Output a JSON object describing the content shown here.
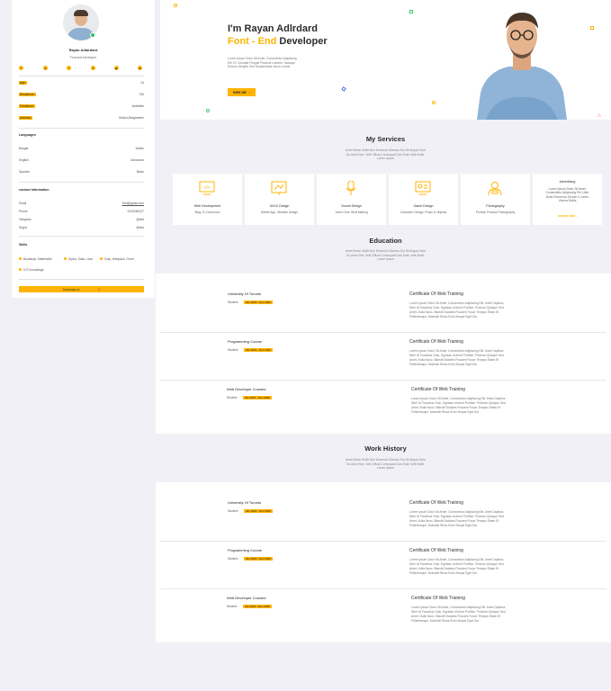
{
  "profile": {
    "name": "Rayan Adlardard",
    "role": "Font-end Developer",
    "social_icons": [
      "facebook-icon",
      "instagram-icon",
      "twitter-icon",
      "linkedin-icon",
      "youtube-icon",
      "dribbble-icon"
    ],
    "info": [
      {
        "label": "Age:",
        "value": "24"
      },
      {
        "label": "Residence:",
        "value": "BD"
      },
      {
        "label": "Freelance:",
        "value": "Available"
      },
      {
        "label": "Address:",
        "value": "Dhaka,Bangladesh"
      }
    ],
    "languages_title": "Languages",
    "languages": [
      {
        "name": "Bangla",
        "level": "Native"
      },
      {
        "name": "English",
        "level": "Advanced"
      },
      {
        "name": "Spanish",
        "level": "Basic"
      }
    ],
    "contact_title": "contact Information",
    "contact": [
      {
        "label": "Email",
        "value": "Test@gmail.com"
      },
      {
        "label": "Phone",
        "value": "0913283127"
      },
      {
        "label": "Telegram",
        "value": "@test"
      },
      {
        "label": "Skype",
        "value": "@test"
      }
    ],
    "skills_title": "Skills",
    "skills": [
      "Bootstrap, Materialize",
      "Stylus, Sass, Less",
      "Gulp, Webpack, Grunt",
      "GIT Knowledge"
    ],
    "download_label": "Download cv"
  },
  "hero": {
    "greeting": "I'm Rayan Adlrdard",
    "accent": "Font - End",
    "title_rest": " Developer",
    "lorem_lines": [
      "Lorem Ipsum Dolor Sit Amet, Consectetur Adipiscing",
      "Elit. Et, Volutpat Feugiat Placerat Lobortis. Natoque",
      "Rutrum Semper Sed Suspendisse Nunc Lectus."
    ],
    "button": "HIRE ME"
  },
  "services": {
    "title": "My Services",
    "subtitle": [
      "Amet Minim Mollit Non Deserunt Ullamco Est Sit Aliqua Dolor",
      "Do Amet Sint. Velit Officia Consequat Duis Enim Velit Mollit.",
      "Lorem Ipsum"
    ],
    "items": [
      {
        "name": "Web Development",
        "desc": "Blog, E-Commerce",
        "icon": "code-monitor-icon"
      },
      {
        "name": "UI/UX Design",
        "desc": "Mobile App, Website Design",
        "icon": "design-board-icon"
      },
      {
        "name": "Sound Design",
        "desc": "Voice Over, Beat Making",
        "icon": "microphone-icon"
      },
      {
        "name": "Game Design",
        "desc": "Character Design, Props & Objects",
        "icon": "game-screen-icon"
      },
      {
        "name": "Photography",
        "desc": "Portrait, Product Photography",
        "icon": "photographer-icon"
      },
      {
        "name": "Advertising",
        "desc_lines": [
          "Lorem Ipsum Dolor Sit Amet,",
          "Consectetur Adipiscing Elit, Ulter",
          "Nulla Dictum Ac Dictum Il Lorem",
          "Viverra Mollis"
        ],
        "link": "ORDER NOW"
      }
    ]
  },
  "education": {
    "title": "Education",
    "subtitle": [
      "Amet Minim Mollit Non Deserunt Ullamco Est Sit Aliqua Dolor",
      "Do Amet Sint. Velit Officia Consequat Duis Enim Velit Mollit.",
      "Lorem Ipsum"
    ],
    "entries": [
      {
        "name": "University Of Toronto",
        "label": "Student",
        "date": "Jan 2016 - Dec 2020",
        "cert": "Certificate Of Web Training",
        "desc": [
          "Lorem Ipsum Dolor Sit Amet, Consectetur Adipiscing Elit. Amet Dapibus",
          "Nibh Ut Faucibus Gutc, Egestas Id Amet Portitior. Pulvinar Quisque Sed",
          "Amet, Nulla Nunc. Blandit Sodales Posuere Fusce Tempus Etiam Et",
          "Pellentesque. Molestie Risus Enim Neque Eget Dui."
        ]
      },
      {
        "name": "Programming Course",
        "label": "Student",
        "date": "Jan 2016 - Dec 2020",
        "cert": "Certificate Of Web Training",
        "desc": [
          "Lorem Ipsum Dolor Sit Amet, Consectetur Adipiscing Elit. Amet Dapibus",
          "Nibh Ut Faucibus Gutc, Egestas Id Amet Portitior. Pulvinar Quisque Sed",
          "Amet, Nulla Nunc. Blandit Sodales Posuere Fusce Tempus Etiam Et",
          "Pellentesque. Molestie Risus Enim Neque Eget Dui."
        ]
      },
      {
        "name": "Web Developer Courses",
        "label": "Student",
        "date": "Jan 2016 - Dec 2020",
        "cert": "Certificate Of Web Training",
        "desc": [
          "Lorem Ipsum Dolor Sit Amet, Consectetur Adipiscing Elit. Amet Dapibus",
          "Nibh Ut Faucibus Gutc, Egestas Id Amet Portitior. Pulvinar Quisque Sed",
          "Amet, Nulla Nunc. Blandit Sodales Posuere Fusce Tempus Etiam Et",
          "Pellentesque. Molestie Risus Enim Neque Eget Dui."
        ]
      }
    ]
  },
  "work": {
    "title": "Work History",
    "subtitle": [
      "Amet Minim Mollit Non Deserunt Ullamco Est Sit Aliqua Dolor",
      "Do Amet Sint. Velit Officia Consequat Duis Enim Velit Mollit.",
      "Lorem Ipsum"
    ],
    "entries": [
      {
        "name": "University Of Toronto",
        "label": "Student",
        "date": "Jan 2016 - Dec 2020",
        "cert": "Certificate Of Web Training",
        "desc": [
          "Lorem Ipsum Dolor Sit Amet, Consectetur Adipiscing Elit. Amet Dapibus",
          "Nibh Ut Faucibus Gutc, Egestas Id Amet Portitior. Pulvinar Quisque Sed",
          "Amet, Nulla Nunc. Blandit Sodales Posuere Fusce Tempus Etiam Et",
          "Pellentesque. Molestie Risus Enim Neque Eget Dui."
        ]
      },
      {
        "name": "Programming Course",
        "label": "Student",
        "date": "Jan 2016 - Dec 2020",
        "cert": "Certificate Of Web Training",
        "desc": [
          "Lorem Ipsum Dolor Sit Amet, Consectetur Adipiscing Elit. Amet Dapibus",
          "Nibh Ut Faucibus Gutc, Egestas Id Amet Portitior. Pulvinar Quisque Sed",
          "Amet, Nulla Nunc. Blandit Sodales Posuere Fusce Tempus Etiam Et",
          "Pellentesque. Molestie Risus Enim Neque Eget Dui."
        ]
      },
      {
        "name": "Web Developer Courses",
        "label": "Student",
        "date": "Jan 2016 - Dec 2020",
        "cert": "Certificate Of Web Training",
        "desc": [
          "Lorem Ipsum Dolor Sit Amet, Consectetur Adipiscing Elit. Amet Dapibus",
          "Nibh Ut Faucibus Gutc, Egestas Id Amet Portitior. Pulvinar Quisque Sed",
          "Amet, Nulla Nunc. Blandit Sodales Posuere Fusce Tempus Etiam Et",
          "Pellentesque. Molestie Risus Enim Neque Eget Dui."
        ]
      }
    ]
  },
  "colors": {
    "accent": "#ffb400",
    "background": "#f0f0f6",
    "card": "#ffffff"
  }
}
